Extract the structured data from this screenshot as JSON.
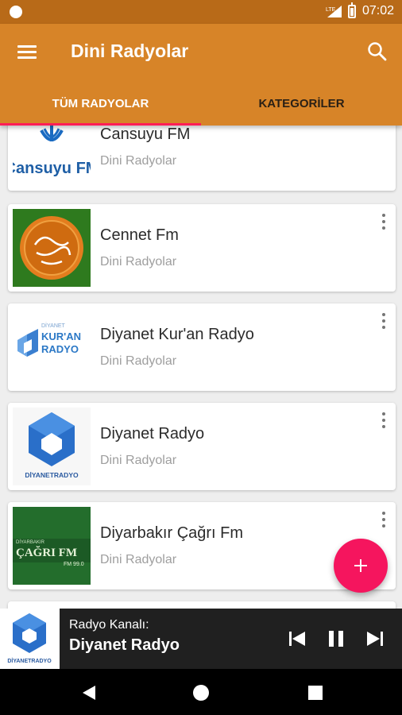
{
  "status_bar": {
    "time": "07:02",
    "network": "LTE"
  },
  "app_bar": {
    "title": "Dini Radyolar",
    "menu_icon": "menu-icon",
    "search_icon": "search-icon"
  },
  "tabs": [
    {
      "label": "TÜM RADYOLAR",
      "active": true
    },
    {
      "label": "KATEGORİLER",
      "active": false
    }
  ],
  "stations": [
    {
      "name": "Cansuyu FM",
      "category": "Dini Radyolar",
      "logo_text": "Cansuyu FM"
    },
    {
      "name": "Cennet Fm",
      "category": "Dini Radyolar",
      "logo_text": ""
    },
    {
      "name": "Diyanet Kur'an Radyo",
      "category": "Dini Radyolar",
      "logo_text": "DİYANET KUR'AN RADYO"
    },
    {
      "name": "Diyanet Radyo",
      "category": "Dini Radyolar",
      "logo_text": "DİYANETRADYO"
    },
    {
      "name": "Diyarbakır Çağrı Fm",
      "category": "Dini Radyolar",
      "logo_text": "ÇAĞRI FM"
    }
  ],
  "player": {
    "label": "Radyo Kanalı:",
    "station": "Diyanet Radyo",
    "logo_text": "DİYANETRADYO"
  },
  "colors": {
    "app_bar": "#d78428",
    "status_bar": "#b86a18",
    "tab_indicator": "#ff1e56",
    "fab": "#f5155e",
    "player_bg": "#202020"
  }
}
